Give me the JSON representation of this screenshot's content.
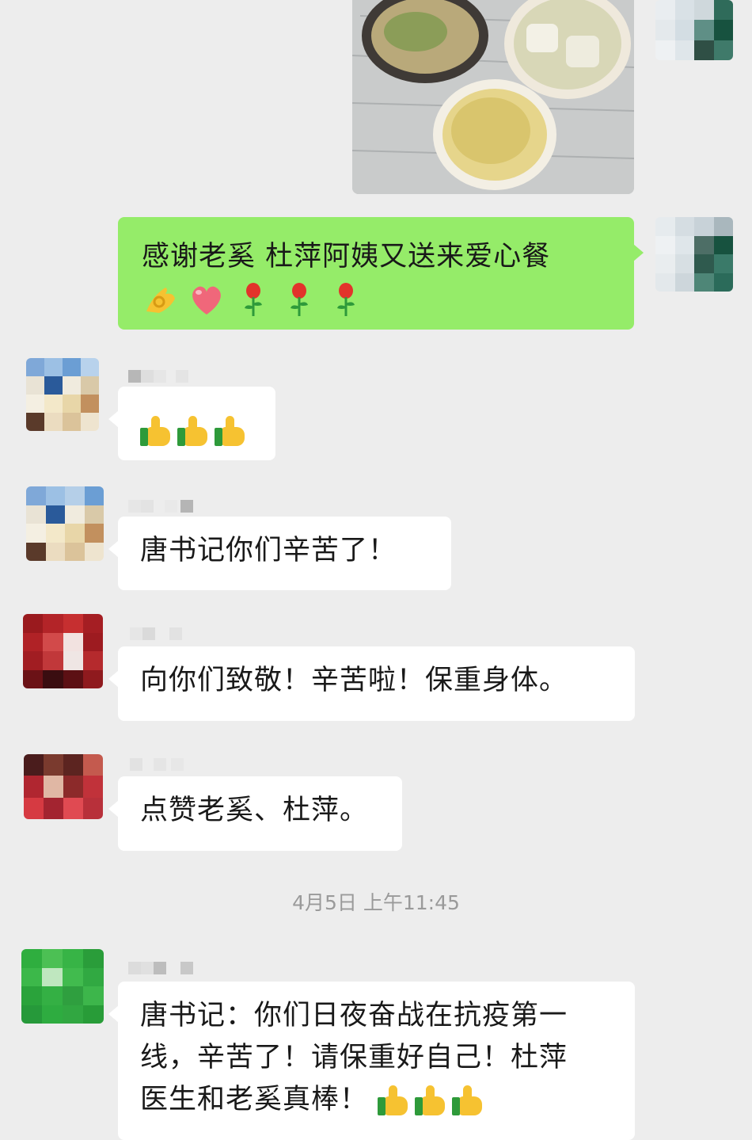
{
  "chat": {
    "photo_message": {
      "alt_icon": "food-photo-icon"
    },
    "outgoing_message": {
      "text": "感谢老奚 杜萍阿姨又送来爱心餐",
      "emojis": [
        "ok-hand-icon",
        "heart-icon",
        "rose-icon",
        "rose-icon",
        "rose-icon"
      ]
    },
    "messages": [
      {
        "text": "",
        "emojis": [
          "thumbs-up-icon",
          "thumbs-up-icon",
          "thumbs-up-icon"
        ]
      },
      {
        "text": "唐书记你们辛苦了！"
      },
      {
        "text": "向你们致敬！辛苦啦！保重身体。"
      },
      {
        "text": "点赞老奚、杜萍。"
      }
    ],
    "timestamp": "4月5日 上午11:45",
    "last_message": {
      "lines": [
        "唐书记：你们日夜奋战在抗疫第一",
        "线，辛苦了！请保重好自己！杜萍",
        "医生和老奚真棒！"
      ],
      "emojis": [
        "thumbs-up-icon",
        "thumbs-up-icon",
        "thumbs-up-icon"
      ]
    }
  },
  "colors": {
    "background": "#ededed",
    "outgoing_bubble": "#95ec69",
    "incoming_bubble": "#ffffff",
    "timestamp_text": "#9a9a9a"
  }
}
